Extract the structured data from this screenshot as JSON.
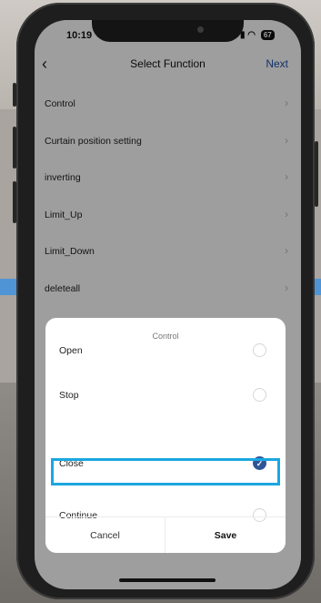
{
  "status": {
    "time": "10:19",
    "battery": "67"
  },
  "nav": {
    "title": "Select Function",
    "next_label": "Next",
    "back_glyph": "‹"
  },
  "functions": [
    {
      "label": "Control"
    },
    {
      "label": "Curtain position setting"
    },
    {
      "label": "inverting"
    },
    {
      "label": "Limit_Up"
    },
    {
      "label": "Limit_Down"
    },
    {
      "label": "deleteall"
    }
  ],
  "dialog": {
    "title": "Control",
    "options": [
      {
        "label": "Open",
        "selected": false
      },
      {
        "label": "Stop",
        "selected": false
      },
      {
        "label": "Close",
        "selected": true
      },
      {
        "label": "Continue",
        "selected": false
      }
    ],
    "cancel_label": "Cancel",
    "save_label": "Save"
  },
  "colors": {
    "accent": "#2f5597",
    "highlight": "#1aa7e0",
    "next": "#1f4fa6"
  }
}
